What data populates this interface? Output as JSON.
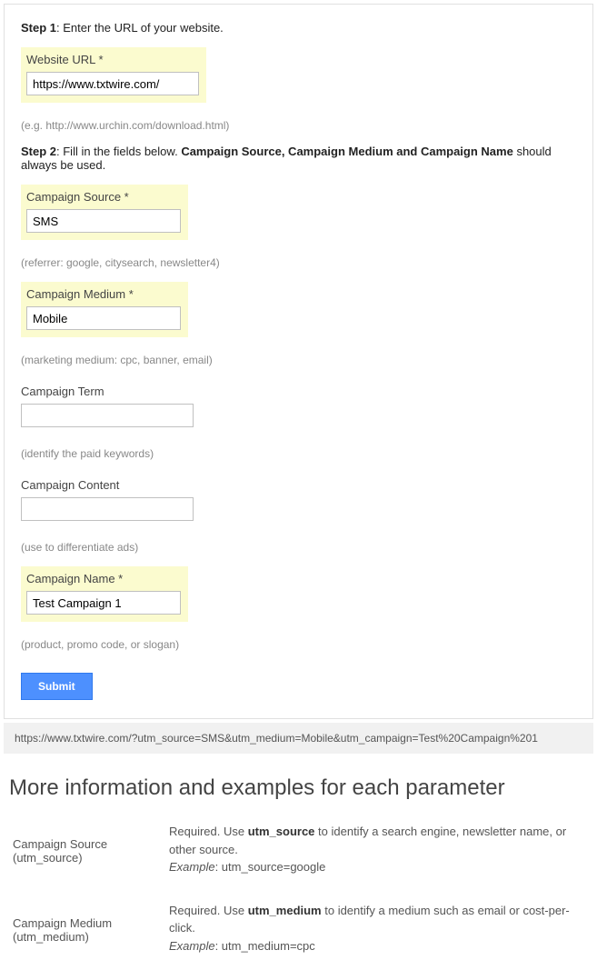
{
  "step1": {
    "label": "Step 1",
    "intro_rest": ": Enter the URL of your website."
  },
  "website_url": {
    "label": "Website URL *",
    "value": "https://www.txtwire.com/",
    "hint": "(e.g. http://www.urchin.com/download.html)"
  },
  "step2": {
    "label": "Step 2",
    "intro_rest1": ": Fill in the fields below. ",
    "bold_part": "Campaign Source, Campaign Medium and Campaign Name",
    "intro_rest2": " should always be used."
  },
  "campaign_source": {
    "label": "Campaign Source *",
    "value": "SMS",
    "hint": "(referrer: google, citysearch, newsletter4)"
  },
  "campaign_medium": {
    "label": "Campaign Medium *",
    "value": "Mobile",
    "hint": "(marketing medium: cpc, banner, email)"
  },
  "campaign_term": {
    "label": "Campaign Term",
    "value": "",
    "hint": "(identify the paid keywords)"
  },
  "campaign_content": {
    "label": "Campaign Content",
    "value": "",
    "hint": "(use to differentiate ads)"
  },
  "campaign_name": {
    "label": "Campaign Name *",
    "value": "Test Campaign 1",
    "hint": "(product, promo code, or slogan)"
  },
  "submit_label": "Submit",
  "result_url": "https://www.txtwire.com/?utm_source=SMS&utm_medium=Mobile&utm_campaign=Test%20Campaign%201",
  "section_title": "More information and examples for each parameter",
  "params": {
    "source": {
      "name": "Campaign Source",
      "alias": "(utm_source)",
      "desc_pre": "Required. Use ",
      "desc_bold": "utm_source",
      "desc_post": " to identify a search engine, newsletter name, or other source.",
      "example_label": "Example",
      "example": ": utm_source=google"
    },
    "medium": {
      "name": "Campaign Medium",
      "alias": "(utm_medium)",
      "desc_pre": "Required. Use ",
      "desc_bold": "utm_medium",
      "desc_post": " to identify a medium such as email or cost-per- click.",
      "example_label": "Example",
      "example": ": utm_medium=cpc"
    }
  }
}
